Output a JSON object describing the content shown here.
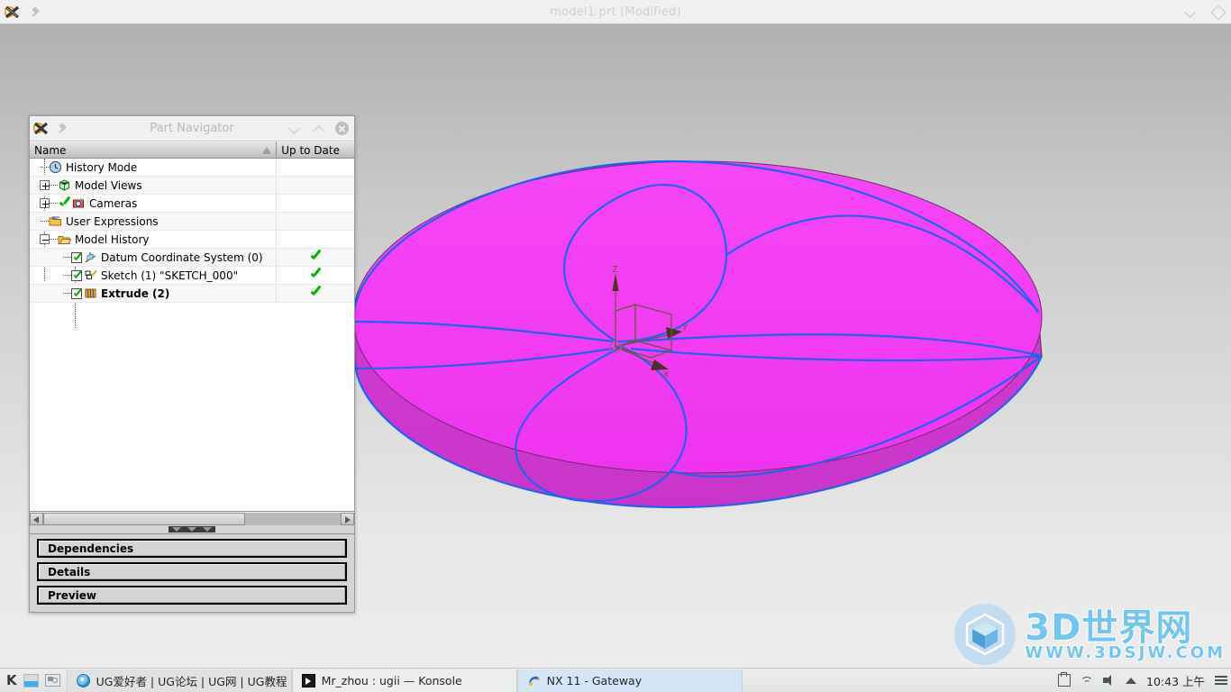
{
  "window": {
    "title": "model1.prt (Modified)",
    "logo_icon": "nx-logo-icon",
    "pin_icon": "pin-icon",
    "collapse_icon": "chevron-down-icon",
    "maximize_icon": "diamond-maximize-icon"
  },
  "part_navigator": {
    "title": "Part Navigator",
    "logo_icon": "nx-logo-icon",
    "pin_icon": "pin-icon",
    "collapse_icon": "chevron-down-icon",
    "expand_icon": "chevron-up-icon",
    "close_icon": "close-icon",
    "columns": [
      {
        "label": "Name",
        "sort_icon": "sort-ascending-icon"
      },
      {
        "label": "Up to Date"
      }
    ],
    "rows": [
      {
        "label": "History Mode",
        "icon": "clock-icon",
        "indent": 1,
        "expander": "none",
        "checkbox": false,
        "status": "",
        "bold": false
      },
      {
        "label": "Model Views",
        "icon": "model-views-icon",
        "indent": 0,
        "expander": "plus",
        "checkbox": false,
        "status": "",
        "bold": false
      },
      {
        "label": "Cameras",
        "icon": "camera-icon",
        "indent": 0,
        "expander": "plus",
        "checkbox": false,
        "status": "check",
        "bold": false,
        "inline_check": true
      },
      {
        "label": "User Expressions",
        "icon": "folder-icon",
        "indent": 1,
        "expander": "none",
        "checkbox": false,
        "status": "",
        "bold": false
      },
      {
        "label": "Model History",
        "icon": "folder-open-icon",
        "indent": 0,
        "expander": "minus",
        "checkbox": false,
        "status": "",
        "bold": false
      },
      {
        "label": "Datum Coordinate System (0)",
        "icon": "datum-csys-icon",
        "indent": 2,
        "expander": "none",
        "checkbox": true,
        "status": "check",
        "bold": false
      },
      {
        "label": "Sketch (1) \"SKETCH_000\"",
        "icon": "sketch-icon",
        "indent": 2,
        "expander": "none",
        "checkbox": true,
        "status": "check",
        "bold": false
      },
      {
        "label": "Extrude (2)",
        "icon": "extrude-icon",
        "indent": 2,
        "expander": "none",
        "checkbox": true,
        "status": "check",
        "bold": true
      }
    ],
    "hscroll": {
      "left_arrow_icon": "scroll-left-icon",
      "right_arrow_icon": "scroll-right-icon"
    },
    "splitter_icon": "splitter-grip-icon",
    "panels": [
      {
        "label": "Dependencies"
      },
      {
        "label": "Details"
      },
      {
        "label": "Preview"
      }
    ]
  },
  "viewport": {
    "csys_labels": {
      "x": "X",
      "y": "Y",
      "z": "Z"
    },
    "colors": {
      "body_top": "#f33cf3",
      "body_side": "#d23ad2",
      "edge_blue": "#1e64f0",
      "edge_dark": "#5a2a5a",
      "background_top": "#b1b1b1",
      "background_bottom": "#ececec"
    }
  },
  "watermark": {
    "main": "3D世界网",
    "sub": "WWW.3DSJW.COM",
    "logo_icon": "cube-logo-icon"
  },
  "taskbar": {
    "system_icons": [
      {
        "name": "kde-launcher-icon",
        "label": "K"
      },
      {
        "name": "show-desktop-icon"
      },
      {
        "name": "pager-icon"
      }
    ],
    "tasks": [
      {
        "label": "UG爱好者 | UG论坛 | UG网 | UG教程 | U",
        "icon": "firefox-icon",
        "active": false
      },
      {
        "label": "Mr_zhou : ugii — Konsole",
        "icon": "konsole-icon",
        "active": false
      },
      {
        "label": "NX 11 - Gateway",
        "icon": "nx-icon",
        "active": true
      }
    ],
    "tray": [
      {
        "name": "clipboard-icon"
      },
      {
        "name": "network-wifi-icon"
      },
      {
        "name": "volume-icon"
      },
      {
        "name": "show-hidden-tray-icon"
      }
    ],
    "clock": "10:43 上午",
    "menu_icon": "hamburger-menu-icon"
  }
}
